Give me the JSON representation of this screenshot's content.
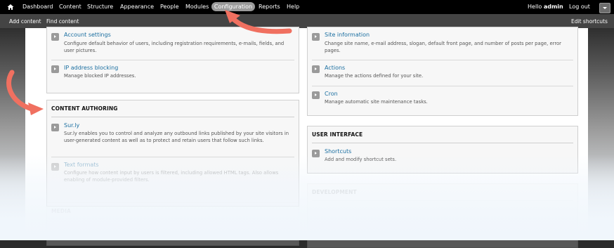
{
  "toolbar": {
    "nav": [
      "Dashboard",
      "Content",
      "Structure",
      "Appearance",
      "People",
      "Modules",
      "Configuration",
      "Reports",
      "Help"
    ],
    "hello_prefix": "Hello ",
    "username": "admin",
    "logout": "Log out"
  },
  "shortcuts_bar": {
    "add_content": "Add content",
    "find_content": "Find content",
    "edit_shortcuts": "Edit shortcuts"
  },
  "left": {
    "top_items": [
      {
        "title": "Account settings",
        "desc": "Configure default behavior of users, including registration requirements, e-mails, fields, and user pictures."
      },
      {
        "title": "IP address blocking",
        "desc": "Manage blocked IP addresses."
      }
    ],
    "content_authoring": {
      "title": "CONTENT AUTHORING",
      "items": [
        {
          "title": "Sur.ly",
          "desc": "Sur.ly enables you to control and analyze any outbound links published by your site visitors in user-generated content as well as to protect and retain users that follow such links."
        },
        {
          "title": "Text formats",
          "desc": "Configure how content input by users is filtered, including allowed HTML tags. Also allows enabling of module-provided filters."
        }
      ]
    },
    "media_title": "MEDIA"
  },
  "right": {
    "top_items": [
      {
        "title": "Site information",
        "desc": "Change site name, e-mail address, slogan, default front page, and number of posts per page, error pages."
      },
      {
        "title": "Actions",
        "desc": "Manage the actions defined for your site."
      },
      {
        "title": "Cron",
        "desc": "Manage automatic site maintenance tasks."
      }
    ],
    "user_interface": {
      "title": "USER INTERFACE",
      "items": [
        {
          "title": "Shortcuts",
          "desc": "Add and modify shortcut sets."
        }
      ]
    },
    "development_title": "DEVELOPMENT"
  },
  "colors": {
    "link": "#1a6ea0",
    "annotation_arrow": "#f07060",
    "toolbar_bg": "#000000",
    "active_tab": "#9a9a9a"
  }
}
